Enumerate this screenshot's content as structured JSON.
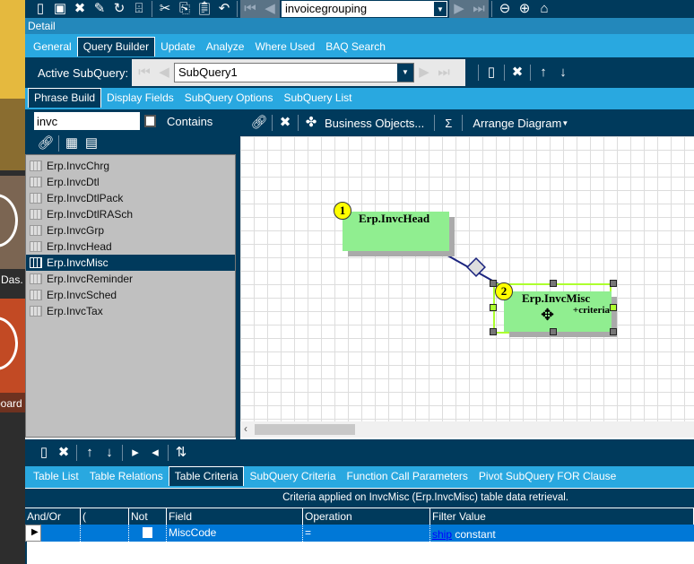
{
  "sidebar": {
    "tile1_label": "Das.",
    "tile2_label": "board"
  },
  "toolbar": {
    "record_select": "invoicegrouping"
  },
  "detail_label": "Detail",
  "main_tabs": [
    {
      "label": "General"
    },
    {
      "label": "Query Builder",
      "active": true
    },
    {
      "label": "Update"
    },
    {
      "label": "Analyze"
    },
    {
      "label": "Where Used"
    },
    {
      "label": "BAQ Search"
    }
  ],
  "subquery": {
    "label": "Active SubQuery:",
    "value": "SubQuery1"
  },
  "sub_tabs": [
    {
      "label": "Phrase Build",
      "active": true
    },
    {
      "label": "Display Fields"
    },
    {
      "label": "SubQuery Options"
    },
    {
      "label": "SubQuery List"
    }
  ],
  "search": {
    "value": "invc",
    "contains_label": "Contains",
    "contains_checked": false
  },
  "tables": [
    "Erp.InvcChrg",
    "Erp.InvcDtl",
    "Erp.InvcDtlPack",
    "Erp.InvcDtlRASch",
    "Erp.InvcGrp",
    "Erp.InvcHead",
    "Erp.InvcMisc",
    "Erp.InvcReminder",
    "Erp.InvcSched",
    "Erp.InvcTax"
  ],
  "selected_table": "Erp.InvcMisc",
  "diagram_toolbar": {
    "business_objects": "Business Objects...",
    "sigma": "Σ",
    "arrange": "Arrange Diagram"
  },
  "diagram": {
    "nodes": [
      {
        "num": "1",
        "name": "Erp.InvcHead",
        "note": ""
      },
      {
        "num": "2",
        "name": "Erp.InvcMisc",
        "note": "+criteria"
      }
    ]
  },
  "bottom_tabs": [
    {
      "label": "Table List"
    },
    {
      "label": "Table Relations"
    },
    {
      "label": "Table Criteria",
      "active": true
    },
    {
      "label": "SubQuery Criteria"
    },
    {
      "label": "Function Call Parameters"
    },
    {
      "label": "Pivot SubQuery FOR Clause"
    }
  ],
  "criteria": {
    "caption": "Criteria applied on InvcMisc (Erp.InvcMisc) table data retrieval.",
    "columns": [
      "And/Or",
      "(",
      "Not",
      "Field",
      "Operation",
      "Filter Value"
    ],
    "rows": [
      {
        "and_or": "",
        "paren": "",
        "not": false,
        "field": "MiscCode",
        "operation": "=",
        "filter_link": "ship",
        "filter_rest": "constant"
      }
    ]
  },
  "colors": {
    "navy": "#003a5c",
    "light_blue": "#29a8e0",
    "node_green": "#90ee90",
    "row_selected": "#0078d7"
  }
}
